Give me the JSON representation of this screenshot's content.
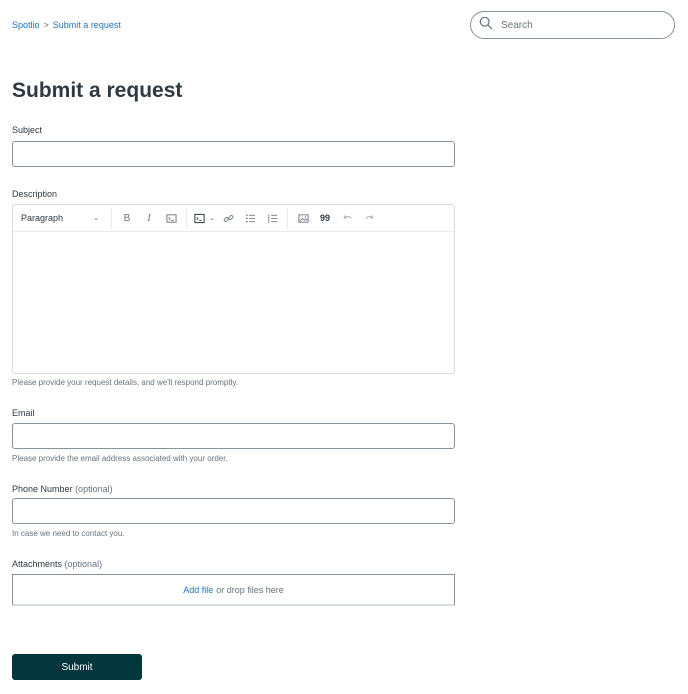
{
  "breadcrumb": {
    "items": [
      "Spotlio",
      "Submit a request"
    ],
    "separator": ">"
  },
  "search": {
    "placeholder": "Search"
  },
  "page_title": "Submit a request",
  "form": {
    "subject": {
      "label": "Subject",
      "value": ""
    },
    "description": {
      "label": "Description",
      "toolbar": {
        "block_format": "Paragraph",
        "buttons": [
          "bold",
          "italic",
          "code-inline",
          "code-block",
          "link",
          "bulleted-list",
          "numbered-list",
          "image",
          "blockquote",
          "undo",
          "redo"
        ]
      },
      "value": "",
      "hint": "Please provide your request details, and we'll respond promptly."
    },
    "email": {
      "label": "Email",
      "value": "",
      "hint": "Please provide the email address associated with your order."
    },
    "phone": {
      "label": "Phone Number",
      "optional": "(optional)",
      "value": "",
      "hint": "In case we need to contact you."
    },
    "attachments": {
      "label": "Attachments",
      "optional": "(optional)",
      "add_file": "Add file",
      "drop_text": "or drop files here"
    },
    "submit_label": "Submit"
  },
  "colors": {
    "link": "#1f73b7",
    "primary_button": "#03363d",
    "text": "#2f3941",
    "muted": "#68737d",
    "border": "#87929d"
  }
}
